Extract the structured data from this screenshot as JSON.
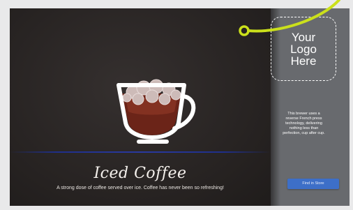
{
  "product": {
    "title": "Iced Coffee",
    "description": "A strong dose of coffee served over ice. Coffee has never been so refreshing!"
  },
  "logo": {
    "lines": [
      "Your",
      "Logo",
      "Here"
    ]
  },
  "sidebar": {
    "text_lines": [
      "This brewer uses a",
      "reverse French press",
      "technology, delivering",
      "nothing less than",
      "perfection, cup after cup."
    ],
    "button_label": "Find in Store"
  },
  "colors": {
    "main_background": "#2a2625",
    "sidebar_background": "#686a6e",
    "callout": "#cbe01b",
    "button": "#3d6fc8",
    "divider": "#2a3aa0"
  },
  "icons": {
    "cup": "iced-coffee-cup-icon",
    "pointer": "callout-pointer-icon"
  }
}
